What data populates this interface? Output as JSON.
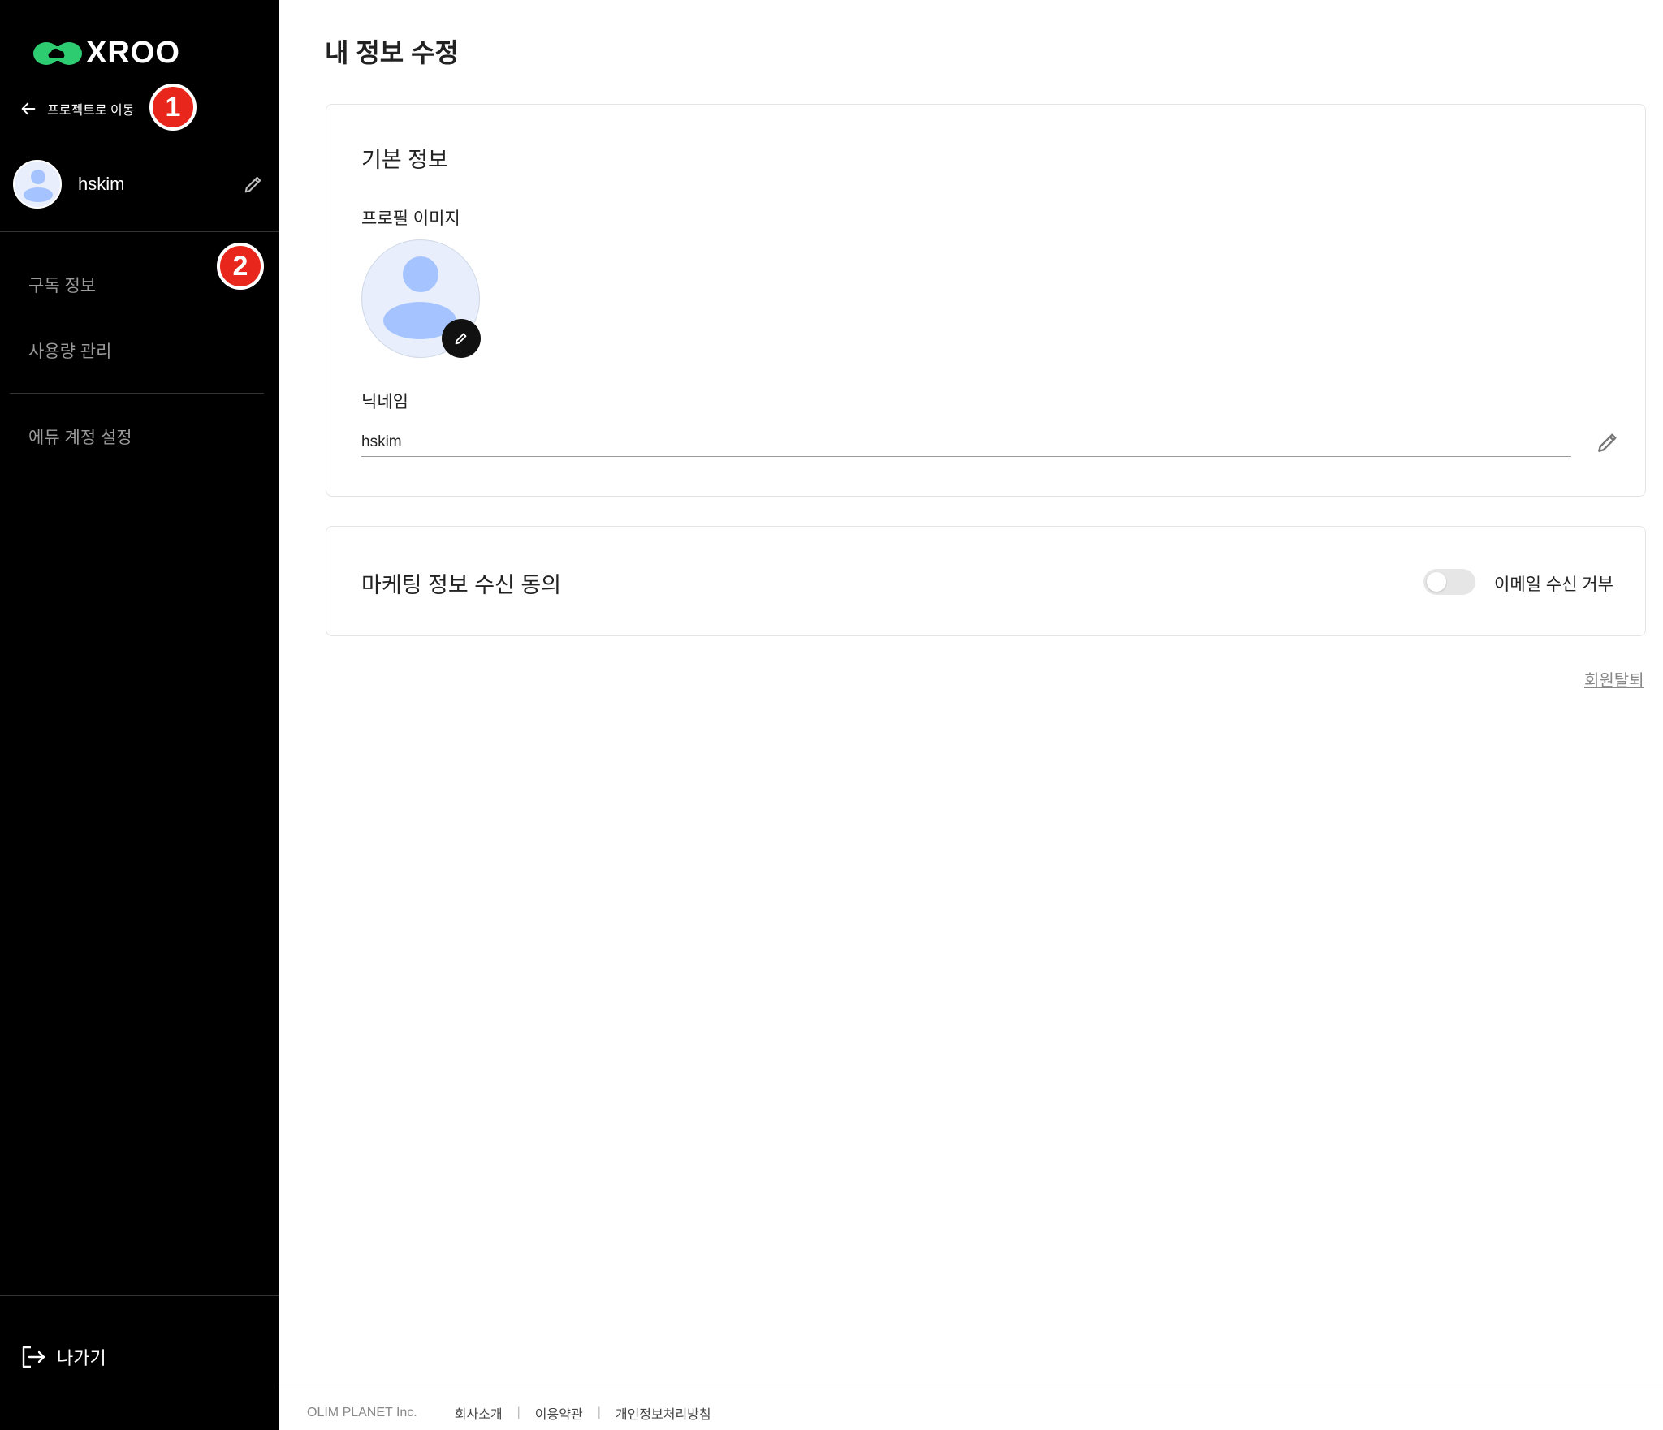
{
  "sidebar": {
    "logo_text": "XROO",
    "back_label": "프로젝트로 이동",
    "badge_1": "1",
    "badge_2": "2",
    "user_name": "hskim",
    "nav": [
      {
        "label": "구독 정보"
      },
      {
        "label": "사용량 관리"
      },
      {
        "label": "에듀 계정 설정"
      }
    ],
    "exit_label": "나가기"
  },
  "main": {
    "page_title": "내 정보 수정",
    "basic": {
      "title": "기본 정보",
      "profile_image_label": "프로필 이미지",
      "nickname_label": "닉네임",
      "nickname_value": "hskim"
    },
    "marketing": {
      "title": "마케팅 정보 수신 동의",
      "toggle_label": "이메일 수신 거부",
      "toggle_on": false
    },
    "withdraw_label": "회원탈퇴"
  },
  "footer": {
    "company": "OLIM PLANET Inc.",
    "links": [
      "회사소개",
      "이용약관",
      "개인정보처리방침"
    ]
  },
  "colors": {
    "sidebar_bg": "#000000",
    "logo_green": "#2ecc71",
    "badge_red": "#e8261b",
    "avatar_blue": "#a5c4ff"
  }
}
